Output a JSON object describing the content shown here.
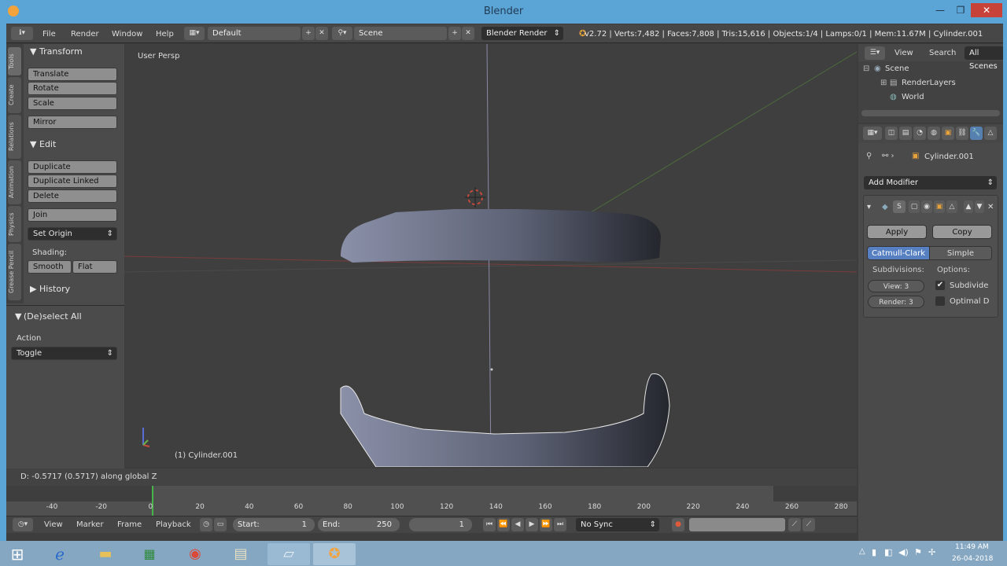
{
  "window": {
    "title": "Blender"
  },
  "topbar": {
    "menus": [
      "File",
      "Render",
      "Window",
      "Help"
    ],
    "layout": "Default",
    "scene": "Scene",
    "engine": "Blender Render",
    "info": "v2.72 | Verts:7,482 | Faces:7,808 | Tris:15,616 | Objects:1/4 | Lamps:0/1 | Mem:11.67M | Cylinder.001"
  },
  "tool_tabs": [
    "Tools",
    "Create",
    "Relations",
    "Animation",
    "Physics",
    "Grease Pencil"
  ],
  "toolshelf": {
    "transform_title": "Transform",
    "translate": "Translate",
    "rotate": "Rotate",
    "scale": "Scale",
    "mirror": "Mirror",
    "edit_title": "Edit",
    "duplicate": "Duplicate",
    "duplicate_linked": "Duplicate Linked",
    "delete": "Delete",
    "join": "Join",
    "set_origin": "Set Origin",
    "shading_label": "Shading:",
    "smooth": "Smooth",
    "flat": "Flat",
    "history": "History",
    "operator_title": "(De)select All",
    "action_label": "Action",
    "action_value": "Toggle"
  },
  "viewport": {
    "label": "User Persp",
    "object_name": "(1) Cylinder.001"
  },
  "status": {
    "text": "D: -0.5717 (0.5717) along global Z"
  },
  "timeline": {
    "ticks": [
      "-40",
      "-20",
      "0",
      "20",
      "40",
      "60",
      "80",
      "100",
      "120",
      "140",
      "160",
      "180",
      "200",
      "220",
      "240",
      "260",
      "280"
    ],
    "current_frame": 0
  },
  "timebar": {
    "menus": [
      "View",
      "Marker",
      "Frame",
      "Playback"
    ],
    "start_label": "Start:",
    "start_value": "1",
    "end_label": "End:",
    "end_value": "250",
    "current": "1",
    "sync": "No Sync"
  },
  "outliner": {
    "tabs": [
      "View",
      "Search",
      "All Scenes"
    ],
    "items": [
      "Scene",
      "RenderLayers",
      "World"
    ]
  },
  "properties": {
    "object": "Cylinder.001",
    "add_modifier": "Add Modifier",
    "modifier_short": "S",
    "apply": "Apply",
    "copy": "Copy",
    "catmull": "Catmull-Clark",
    "simple": "Simple",
    "subdivisions": "Subdivisions:",
    "options": "Options:",
    "view": "View:",
    "view_value": "3",
    "render": "Render:",
    "render_value": "3",
    "subdivide_uvs": "Subdivide",
    "optimal": "Optimal D"
  },
  "taskbar": {
    "time": "11:49 AM",
    "date": "26-04-2018"
  }
}
